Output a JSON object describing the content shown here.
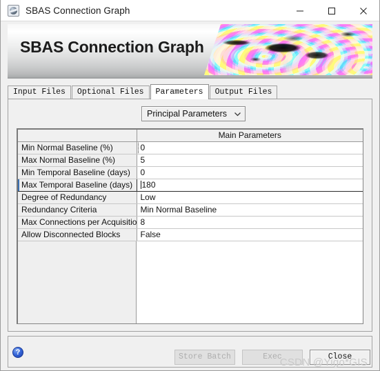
{
  "window": {
    "title": "SBAS Connection Graph",
    "app_icon": "globe-app-icon",
    "controls": {
      "minimize": "minimize-icon",
      "maximize": "maximize-icon",
      "close": "close-icon"
    }
  },
  "banner": {
    "heading": "SBAS Connection Graph",
    "image_alt": "interferogram-fringe-image"
  },
  "tabs": [
    {
      "label": "Input Files",
      "active": false
    },
    {
      "label": "Optional Files",
      "active": false
    },
    {
      "label": "Parameters",
      "active": true
    },
    {
      "label": "Output Files",
      "active": false
    }
  ],
  "parameter_set_select": {
    "value": "Principal Parameters",
    "chevron": "chevron-down-icon"
  },
  "table": {
    "headers": [
      "",
      "Main Parameters"
    ],
    "rows": [
      {
        "name": "Min Normal Baseline (%)",
        "value": "0",
        "state": "focus-dotted"
      },
      {
        "name": "Max Normal Baseline (%)",
        "value": "5",
        "state": "normal"
      },
      {
        "name": "Min Temporal Baseline (days)",
        "value": "0",
        "state": "normal"
      },
      {
        "name": "Max Temporal Baseline (days)",
        "value": "180",
        "state": "selected"
      },
      {
        "name": "Degree of Redundancy",
        "value": "Low",
        "state": "normal"
      },
      {
        "name": "Redundancy Criteria",
        "value": "Min Normal Baseline",
        "state": "normal"
      },
      {
        "name": "Max Connections per Acquisition",
        "value": "8",
        "state": "normal"
      },
      {
        "name": "Allow Disconnected Blocks",
        "value": "False",
        "state": "normal"
      }
    ]
  },
  "footer": {
    "help_icon": "help-question-icon",
    "help_label": "?",
    "buttons": [
      {
        "label": "Store Batch",
        "enabled": false
      },
      {
        "label": "Exec",
        "enabled": false
      },
      {
        "label": "Close",
        "enabled": true
      }
    ],
    "watermark": "CSDN @Yigo*GIS"
  },
  "colors": {
    "window_bg": "#f0f0f0",
    "titlebar_bg": "#ffffff",
    "table_name_bg": "#efefef",
    "table_value_bg": "#ffffff",
    "accent_help": "#3565d8",
    "disabled_text": "#aeaeae"
  }
}
